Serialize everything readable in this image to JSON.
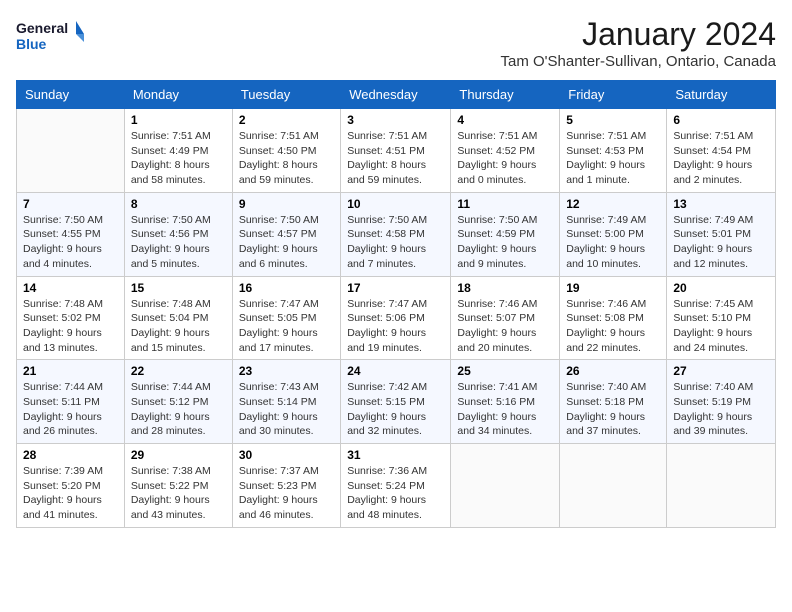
{
  "header": {
    "logo_general": "General",
    "logo_blue": "Blue",
    "month_title": "January 2024",
    "location": "Tam O'Shanter-Sullivan, Ontario, Canada"
  },
  "days_of_week": [
    "Sunday",
    "Monday",
    "Tuesday",
    "Wednesday",
    "Thursday",
    "Friday",
    "Saturday"
  ],
  "weeks": [
    [
      {
        "day": "",
        "content": ""
      },
      {
        "day": "1",
        "content": "Sunrise: 7:51 AM\nSunset: 4:49 PM\nDaylight: 8 hours\nand 58 minutes."
      },
      {
        "day": "2",
        "content": "Sunrise: 7:51 AM\nSunset: 4:50 PM\nDaylight: 8 hours\nand 59 minutes."
      },
      {
        "day": "3",
        "content": "Sunrise: 7:51 AM\nSunset: 4:51 PM\nDaylight: 8 hours\nand 59 minutes."
      },
      {
        "day": "4",
        "content": "Sunrise: 7:51 AM\nSunset: 4:52 PM\nDaylight: 9 hours\nand 0 minutes."
      },
      {
        "day": "5",
        "content": "Sunrise: 7:51 AM\nSunset: 4:53 PM\nDaylight: 9 hours\nand 1 minute."
      },
      {
        "day": "6",
        "content": "Sunrise: 7:51 AM\nSunset: 4:54 PM\nDaylight: 9 hours\nand 2 minutes."
      }
    ],
    [
      {
        "day": "7",
        "content": "Sunrise: 7:50 AM\nSunset: 4:55 PM\nDaylight: 9 hours\nand 4 minutes."
      },
      {
        "day": "8",
        "content": "Sunrise: 7:50 AM\nSunset: 4:56 PM\nDaylight: 9 hours\nand 5 minutes."
      },
      {
        "day": "9",
        "content": "Sunrise: 7:50 AM\nSunset: 4:57 PM\nDaylight: 9 hours\nand 6 minutes."
      },
      {
        "day": "10",
        "content": "Sunrise: 7:50 AM\nSunset: 4:58 PM\nDaylight: 9 hours\nand 7 minutes."
      },
      {
        "day": "11",
        "content": "Sunrise: 7:50 AM\nSunset: 4:59 PM\nDaylight: 9 hours\nand 9 minutes."
      },
      {
        "day": "12",
        "content": "Sunrise: 7:49 AM\nSunset: 5:00 PM\nDaylight: 9 hours\nand 10 minutes."
      },
      {
        "day": "13",
        "content": "Sunrise: 7:49 AM\nSunset: 5:01 PM\nDaylight: 9 hours\nand 12 minutes."
      }
    ],
    [
      {
        "day": "14",
        "content": "Sunrise: 7:48 AM\nSunset: 5:02 PM\nDaylight: 9 hours\nand 13 minutes."
      },
      {
        "day": "15",
        "content": "Sunrise: 7:48 AM\nSunset: 5:04 PM\nDaylight: 9 hours\nand 15 minutes."
      },
      {
        "day": "16",
        "content": "Sunrise: 7:47 AM\nSunset: 5:05 PM\nDaylight: 9 hours\nand 17 minutes."
      },
      {
        "day": "17",
        "content": "Sunrise: 7:47 AM\nSunset: 5:06 PM\nDaylight: 9 hours\nand 19 minutes."
      },
      {
        "day": "18",
        "content": "Sunrise: 7:46 AM\nSunset: 5:07 PM\nDaylight: 9 hours\nand 20 minutes."
      },
      {
        "day": "19",
        "content": "Sunrise: 7:46 AM\nSunset: 5:08 PM\nDaylight: 9 hours\nand 22 minutes."
      },
      {
        "day": "20",
        "content": "Sunrise: 7:45 AM\nSunset: 5:10 PM\nDaylight: 9 hours\nand 24 minutes."
      }
    ],
    [
      {
        "day": "21",
        "content": "Sunrise: 7:44 AM\nSunset: 5:11 PM\nDaylight: 9 hours\nand 26 minutes."
      },
      {
        "day": "22",
        "content": "Sunrise: 7:44 AM\nSunset: 5:12 PM\nDaylight: 9 hours\nand 28 minutes."
      },
      {
        "day": "23",
        "content": "Sunrise: 7:43 AM\nSunset: 5:14 PM\nDaylight: 9 hours\nand 30 minutes."
      },
      {
        "day": "24",
        "content": "Sunrise: 7:42 AM\nSunset: 5:15 PM\nDaylight: 9 hours\nand 32 minutes."
      },
      {
        "day": "25",
        "content": "Sunrise: 7:41 AM\nSunset: 5:16 PM\nDaylight: 9 hours\nand 34 minutes."
      },
      {
        "day": "26",
        "content": "Sunrise: 7:40 AM\nSunset: 5:18 PM\nDaylight: 9 hours\nand 37 minutes."
      },
      {
        "day": "27",
        "content": "Sunrise: 7:40 AM\nSunset: 5:19 PM\nDaylight: 9 hours\nand 39 minutes."
      }
    ],
    [
      {
        "day": "28",
        "content": "Sunrise: 7:39 AM\nSunset: 5:20 PM\nDaylight: 9 hours\nand 41 minutes."
      },
      {
        "day": "29",
        "content": "Sunrise: 7:38 AM\nSunset: 5:22 PM\nDaylight: 9 hours\nand 43 minutes."
      },
      {
        "day": "30",
        "content": "Sunrise: 7:37 AM\nSunset: 5:23 PM\nDaylight: 9 hours\nand 46 minutes."
      },
      {
        "day": "31",
        "content": "Sunrise: 7:36 AM\nSunset: 5:24 PM\nDaylight: 9 hours\nand 48 minutes."
      },
      {
        "day": "",
        "content": ""
      },
      {
        "day": "",
        "content": ""
      },
      {
        "day": "",
        "content": ""
      }
    ]
  ]
}
